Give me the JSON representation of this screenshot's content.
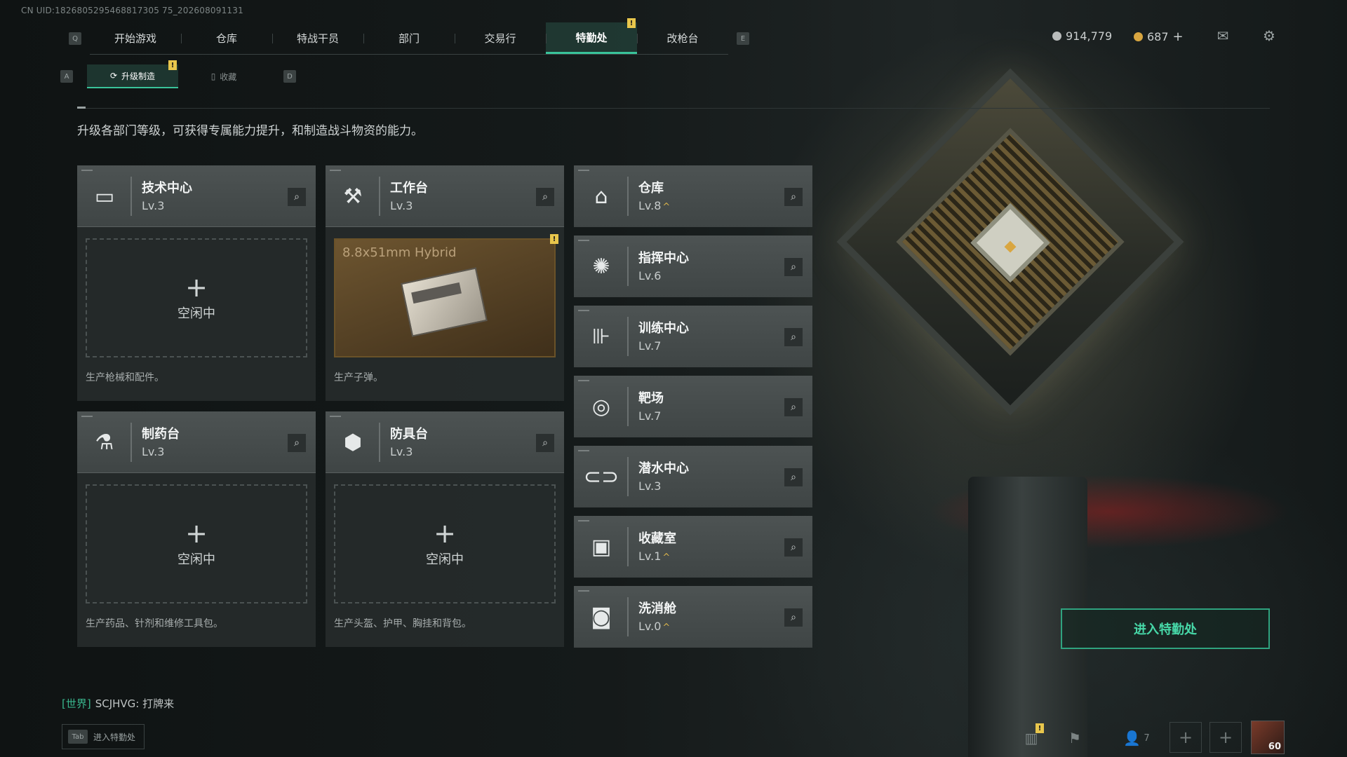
{
  "uid": "CN UID:1826805295468817305 75_202608091131",
  "nav": {
    "key_left": "Q",
    "key_right": "E",
    "tabs": [
      "开始游戏",
      "仓库",
      "特战干员",
      "部门",
      "交易行",
      "特勤处",
      "改枪台"
    ],
    "active_index": 5,
    "badge": "!"
  },
  "currency": {
    "silver": "914,779",
    "gold": "687"
  },
  "subnav": {
    "key_left": "A",
    "key_right": "D",
    "tabs": [
      "升级制造",
      "收藏"
    ],
    "active_index": 0
  },
  "description": "升级各部门等级，可获得专属能力提升，和制造战斗物资的能力。",
  "production": [
    {
      "name": "技术中心",
      "level": "Lv.3",
      "icon": "tech-center-icon",
      "slot": {
        "plus": "+",
        "status": "空闲中"
      },
      "desc": "生产枪械和配件。"
    },
    {
      "name": "工作台",
      "level": "Lv.3",
      "icon": "workbench-icon",
      "slot": {
        "item": "8.8x51mm Hybrid"
      },
      "desc": "生产子弹。"
    },
    {
      "name": "制药台",
      "level": "Lv.3",
      "icon": "pharmacy-icon",
      "slot": {
        "plus": "+",
        "status": "空闲中"
      },
      "desc": "生产药品、针剂和维修工具包。"
    },
    {
      "name": "防具台",
      "level": "Lv.3",
      "icon": "armor-bench-icon",
      "slot": {
        "plus": "+",
        "status": "空闲中"
      },
      "desc": "生产头盔、护甲、胸挂和背包。"
    }
  ],
  "facilities": [
    {
      "name": "仓库",
      "level": "Lv.8",
      "icon": "warehouse-icon",
      "upgrade": "^"
    },
    {
      "name": "指挥中心",
      "level": "Lv.6",
      "icon": "command-center-icon"
    },
    {
      "name": "训练中心",
      "level": "Lv.7",
      "icon": "training-center-icon"
    },
    {
      "name": "靶场",
      "level": "Lv.7",
      "icon": "shooting-range-icon"
    },
    {
      "name": "潜水中心",
      "level": "Lv.3",
      "icon": "diving-center-icon"
    },
    {
      "name": "收藏室",
      "level": "Lv.1",
      "icon": "collection-room-icon",
      "upgrade": "^"
    },
    {
      "name": "洗消舱",
      "level": "Lv.0",
      "icon": "decon-chamber-icon",
      "upgrade": "^"
    }
  ],
  "enter_button": "进入特勤处",
  "chat": {
    "channel": "[世界]",
    "message": "SCJHVG: 打牌来"
  },
  "tab_hint": {
    "key": "Tab",
    "label": "进入特勤处"
  },
  "bottom": {
    "friends_count": "7",
    "avatar_level": "60"
  },
  "colors": {
    "accent": "#39c39a",
    "badge": "#e8c64c",
    "upgrade": "#d8b24a"
  }
}
